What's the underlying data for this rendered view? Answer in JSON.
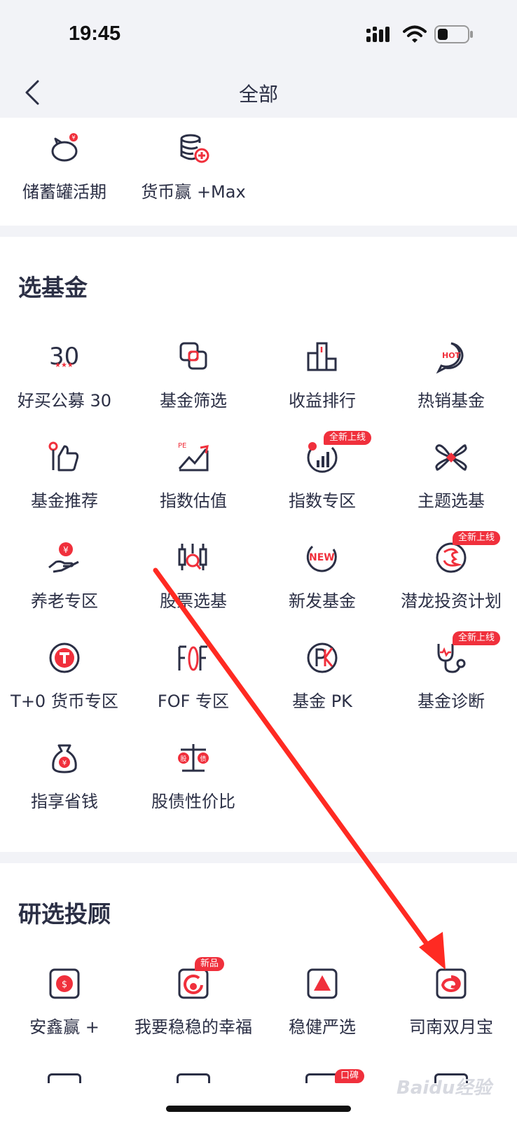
{
  "status": {
    "time": "19:45"
  },
  "nav": {
    "title": "全部"
  },
  "top_items": [
    {
      "label": "储蓄罐活期",
      "icon": "piggy-bank-icon"
    },
    {
      "label": "货币赢 +Max",
      "icon": "coin-stack-plus-icon"
    }
  ],
  "sections": [
    {
      "title": "选基金",
      "items": [
        {
          "label": "好买公募 30",
          "icon": "number-30-icon"
        },
        {
          "label": "基金筛选",
          "icon": "overlap-squares-icon"
        },
        {
          "label": "收益排行",
          "icon": "podium-icon"
        },
        {
          "label": "热销基金",
          "icon": "hot-bubble-icon"
        },
        {
          "label": "基金推荐",
          "icon": "thumbs-up-icon"
        },
        {
          "label": "指数估值",
          "icon": "pe-chart-icon"
        },
        {
          "label": "指数专区",
          "icon": "index-gauge-icon",
          "badge": "全新上线"
        },
        {
          "label": "主题选基",
          "icon": "clover-icon"
        },
        {
          "label": "养老专区",
          "icon": "hand-coin-icon"
        },
        {
          "label": "股票选基",
          "icon": "candlestick-search-icon"
        },
        {
          "label": "新发基金",
          "icon": "new-badge-icon"
        },
        {
          "label": "潜龙投资计划",
          "icon": "dragon-icon",
          "badge": "全新上线"
        },
        {
          "label": "T+0 货币专区",
          "icon": "t-zero-icon"
        },
        {
          "label": "FOF 专区",
          "icon": "fof-icon"
        },
        {
          "label": "基金 PK",
          "icon": "pk-icon"
        },
        {
          "label": "基金诊断",
          "icon": "stethoscope-icon",
          "badge": "全新上线"
        },
        {
          "label": "指享省钱",
          "icon": "money-bag-icon"
        },
        {
          "label": "股债性价比",
          "icon": "balance-scale-icon"
        }
      ]
    },
    {
      "title": "研选投顾",
      "items": [
        {
          "label": "安鑫赢 +",
          "icon": "dollar-box-icon"
        },
        {
          "label": "我要稳稳的幸福",
          "icon": "circle-arrow-box-icon",
          "badge": "新品"
        },
        {
          "label": "稳健严选",
          "icon": "triangle-box-icon"
        },
        {
          "label": "司南双月宝",
          "icon": "spiral-box-icon"
        }
      ]
    }
  ],
  "partial_row_badge": "口碑",
  "watermark": "Baidu经验",
  "colors": {
    "accent": "#f0303c",
    "ink": "#2b2f45",
    "arrow": "#ff2a22"
  }
}
